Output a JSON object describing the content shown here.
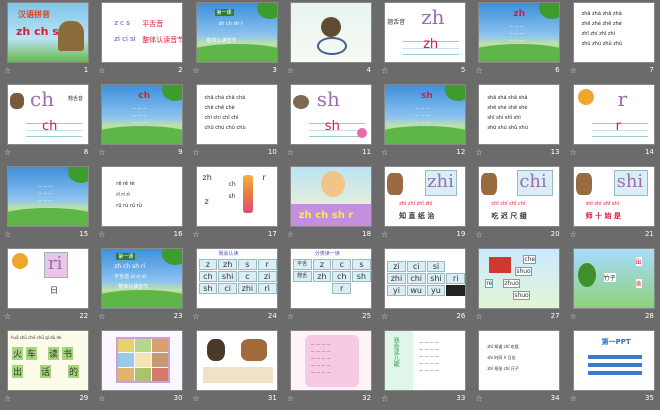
{
  "slides": [
    {
      "n": "1",
      "title": "汉语拼音",
      "sub": "zh ch sh r"
    },
    {
      "n": "2",
      "l1": "z c s",
      "l1b": "平舌音",
      "l2": "zi ci si",
      "l2b": "整体认读音节"
    },
    {
      "n": "3",
      "tag": "第一课",
      "small": "zh ch sh r",
      "foot": "整体认读音节"
    },
    {
      "n": "4"
    },
    {
      "n": "5",
      "big": "zh",
      "big2": "zh",
      "cap": "翘舌音"
    },
    {
      "n": "6",
      "big": "zh"
    },
    {
      "n": "7",
      "rows": [
        "zhā zhá zhǎ zhà",
        "zhē zhé zhě zhè",
        "zhī zhí zhǐ zhì",
        "zhū zhú zhǔ zhù"
      ]
    },
    {
      "n": "8",
      "big": "ch",
      "big2": "ch",
      "cap": "翘舌音"
    },
    {
      "n": "9",
      "big": "ch"
    },
    {
      "n": "10",
      "rows": [
        "chā chá chǎ chà",
        "chē chě chè",
        "chī chí chǐ chì",
        "chū chú chǔ chù"
      ]
    },
    {
      "n": "11",
      "big": "sh",
      "big2": "sh"
    },
    {
      "n": "12",
      "big": "sh"
    },
    {
      "n": "13",
      "rows": [
        "shā shá shǎ shà",
        "shē shé shě shè",
        "shī shí shǐ shì",
        "shū shú shǔ shù"
      ]
    },
    {
      "n": "14",
      "big": "r",
      "big2": "r"
    },
    {
      "n": "15"
    },
    {
      "n": "16",
      "rows": [
        "rē rě rè",
        "rī rí rì",
        "rū rú rǔ rù"
      ]
    },
    {
      "n": "17",
      "a": "zh",
      "b": "ch",
      "c": "sh",
      "d": "r",
      "e": "z"
    },
    {
      "n": "18",
      "bar": "zh ch sh r"
    },
    {
      "n": "19",
      "big": "zhi",
      "py": "zhī zhí zhǐ zhì",
      "hz": "知 直 纸 治"
    },
    {
      "n": "20",
      "big": "chi",
      "py": "chī chí chǐ chì",
      "hz": "吃 迟 尺 翅"
    },
    {
      "n": "21",
      "big": "shi",
      "py": "shī shí shǐ shì",
      "hz": "师 十 始 是"
    },
    {
      "n": "22",
      "big": "ri",
      "hz": "日"
    },
    {
      "n": "23",
      "tag": "第一课",
      "l1": "zh ch sh ri",
      "l2": "平舌音 zi ci si",
      "foot": "整体认读音节"
    },
    {
      "n": "24",
      "head": "我会认读",
      "cells": [
        "z",
        "zh",
        "s",
        "r",
        "ch",
        "shi",
        "c",
        "zi",
        "sh",
        "ci",
        "zhi",
        "ri"
      ]
    },
    {
      "n": "25",
      "head": "分类读一读",
      "rows": [
        [
          "平舌",
          "z",
          "c",
          "s"
        ],
        [
          "翘舌",
          "zh",
          "ch",
          "sh"
        ],
        [
          "",
          "",
          "r",
          ""
        ]
      ]
    },
    {
      "n": "26",
      "cells": [
        "zi",
        "ci",
        "si",
        "zhi",
        "chi",
        "shi",
        "ri",
        "yi",
        "wu",
        "yu"
      ]
    },
    {
      "n": "27",
      "cards": [
        "che",
        "shuo",
        "zhuo",
        "shuo",
        "re"
      ]
    },
    {
      "n": "28",
      "a": "竹子",
      "b": "出",
      "c": "舍"
    },
    {
      "n": "29",
      "py": "huǒ shū chē chū qí dú de",
      "hz": [
        "火",
        "车",
        "读",
        "书",
        "出",
        "话",
        "的"
      ]
    },
    {
      "n": "30"
    },
    {
      "n": "31"
    },
    {
      "n": "32"
    },
    {
      "n": "33",
      "v": "我会读儿歌"
    },
    {
      "n": "34",
      "rows": [
        "zhī 知道 chī 吃饭",
        "shí 时间 rì 日出",
        "zhǐ 纸张 chǐ 尺子"
      ]
    },
    {
      "n": "35",
      "brand": "第一PPT"
    }
  ]
}
